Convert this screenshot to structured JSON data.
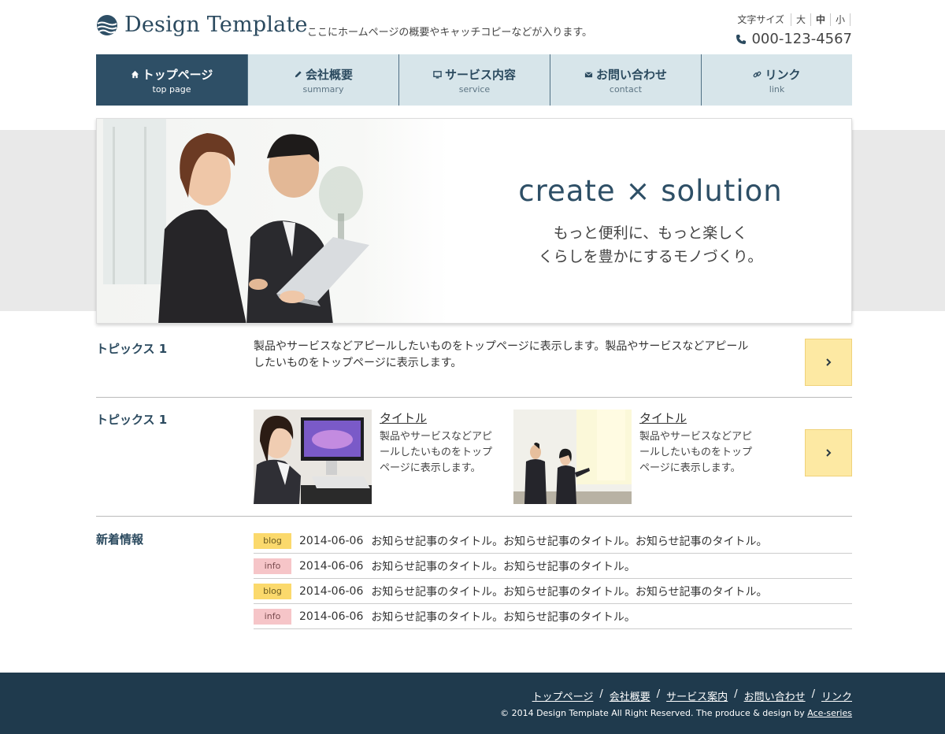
{
  "header": {
    "logo_text": "Design Template",
    "catch_copy": "ここにホームページの概要やキャッチコピーなどが入ります。",
    "font_size_label": "文字サイズ",
    "font_sizes": [
      "大",
      "中",
      "小"
    ],
    "font_size_selected": "中",
    "phone": "000-123-4567"
  },
  "nav": [
    {
      "label": "トップページ",
      "sub": "top page",
      "icon": "home-icon",
      "active": true
    },
    {
      "label": "会社概要",
      "sub": "summary",
      "icon": "pencil-icon",
      "active": false
    },
    {
      "label": "サービス内容",
      "sub": "service",
      "icon": "monitor-icon",
      "active": false
    },
    {
      "label": "お問い合わせ",
      "sub": "contact",
      "icon": "envelope-icon",
      "active": false
    },
    {
      "label": "リンク",
      "sub": "link",
      "icon": "chain-link-icon",
      "active": false
    }
  ],
  "hero": {
    "title": "create × solution",
    "line1": "もっと便利に、もっと楽しく",
    "line2": "くらしを豊かにするモノづくり。"
  },
  "topics": [
    {
      "label": "トピックス 1",
      "text": "製品やサービスなどアピールしたいものをトップページに表示します。製品やサービスなどアピールしたいものをトップページに表示します。"
    },
    {
      "label": "トピックス 1",
      "cards": [
        {
          "title": "タイトル",
          "text": "製品やサービスなどアピールしたいものをトップページに表示します。"
        },
        {
          "title": "タイトル",
          "text": "製品やサービスなどアピールしたいものをトップページに表示します。"
        }
      ]
    }
  ],
  "news": {
    "label": "新着情報",
    "items": [
      {
        "tag": "blog",
        "date": "2014-06-06",
        "title": "お知らせ記事のタイトル。お知らせ記事のタイトル。お知らせ記事のタイトル。"
      },
      {
        "tag": "info",
        "date": "2014-06-06",
        "title": "お知らせ記事のタイトル。お知らせ記事のタイトル。"
      },
      {
        "tag": "blog",
        "date": "2014-06-06",
        "title": "お知らせ記事のタイトル。お知らせ記事のタイトル。お知らせ記事のタイトル。"
      },
      {
        "tag": "info",
        "date": "2014-06-06",
        "title": "お知らせ記事のタイトル。お知らせ記事のタイトル。"
      }
    ]
  },
  "footer": {
    "links": [
      "トップページ",
      "会社概要",
      "サービス案内",
      "お問い合わせ",
      "リンク"
    ],
    "separator": "/",
    "copyright": "© 2014 Design Template All Right Reserved. The produce & design by",
    "credit_link": "Ace-series"
  },
  "colors": {
    "primary": "#2e4f66",
    "nav_bg": "#d7e5ea",
    "accent_button": "#fde9a3",
    "badge_blog": "#fbd96c",
    "badge_info": "#f6c5c8",
    "footer_bg": "#1f3a4d"
  }
}
